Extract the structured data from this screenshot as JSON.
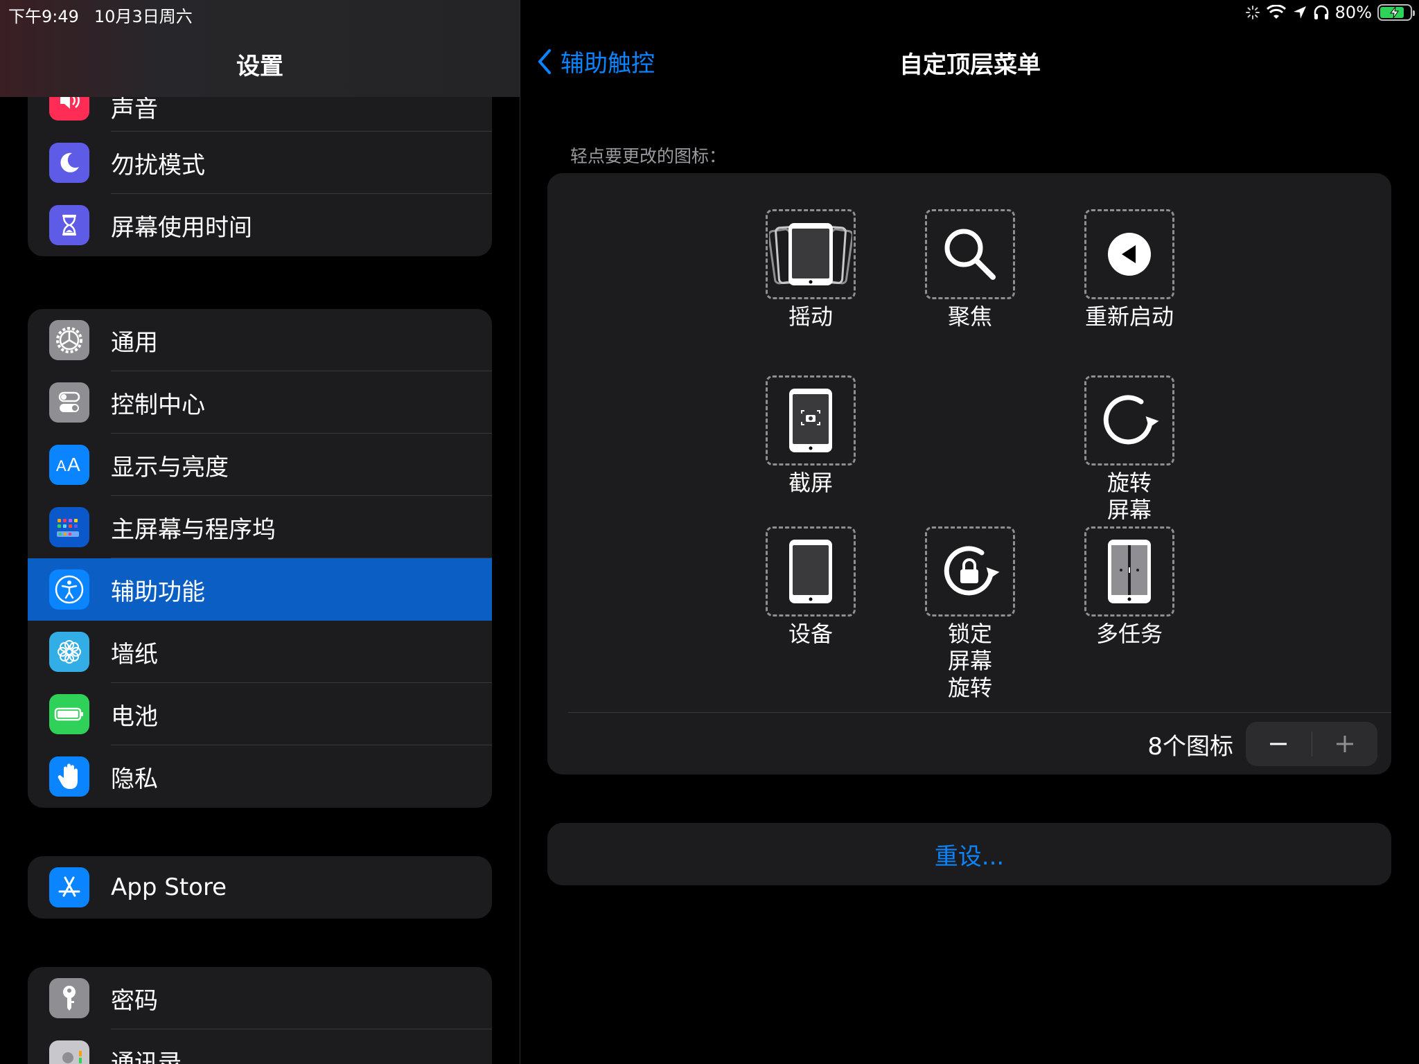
{
  "status": {
    "time": "下午9:49",
    "date": "10月3日周六",
    "battery": "80%",
    "battery_level": 0.8
  },
  "sidebar": {
    "title": "设置",
    "groups": [
      {
        "items": [
          {
            "label": "声音",
            "icon": "speaker-icon",
            "color": "#ff2d55"
          },
          {
            "label": "勿扰模式",
            "icon": "moon-icon",
            "color": "#5e5ce6"
          },
          {
            "label": "屏幕使用时间",
            "icon": "hourglass-icon",
            "color": "#5e5ce6"
          }
        ]
      },
      {
        "items": [
          {
            "label": "通用",
            "icon": "gear-icon",
            "color": "#8e8e93"
          },
          {
            "label": "控制中心",
            "icon": "toggles-icon",
            "color": "#8e8e93"
          },
          {
            "label": "显示与亮度",
            "icon": "text-size-icon",
            "color": "#0a84ff"
          },
          {
            "label": "主屏幕与程序坞",
            "icon": "home-grid-icon",
            "color": "#0a58ca"
          },
          {
            "label": "辅助功能",
            "icon": "accessibility-icon",
            "color": "#0a84ff",
            "selected": true
          },
          {
            "label": "墙纸",
            "icon": "flower-icon",
            "color": "#32ade6"
          },
          {
            "label": "电池",
            "icon": "battery-icon",
            "color": "#30d158"
          },
          {
            "label": "隐私",
            "icon": "hand-icon",
            "color": "#0a84ff"
          }
        ]
      },
      {
        "items": [
          {
            "label": "App Store",
            "icon": "app-store-icon",
            "color": "#0a84ff"
          }
        ]
      },
      {
        "items": [
          {
            "label": "密码",
            "icon": "key-icon",
            "color": "#8e8e93"
          },
          {
            "label": "通讯录",
            "icon": "contacts-icon",
            "color": "#c7c7cc"
          }
        ]
      }
    ]
  },
  "main": {
    "back_label": "辅助触控",
    "title": "自定顶层菜单",
    "hint": "轻点要更改的图标：",
    "tiles": [
      {
        "label": "摇动",
        "icon": "shake-icon"
      },
      {
        "label": "聚焦",
        "icon": "magnifier-icon"
      },
      {
        "label": "重新启动",
        "icon": "restart-icon"
      },
      {
        "label": "截屏",
        "icon": "screenshot-icon"
      },
      {
        "label": "旋转\n屏幕",
        "icon": "rotate-icon"
      },
      {
        "label": "设备",
        "icon": "device-icon"
      },
      {
        "label": "锁定\n屏幕\n旋转",
        "icon": "lock-rotation-icon"
      },
      {
        "label": "多任务",
        "icon": "multitask-icon"
      }
    ],
    "count_label": "8个图标",
    "reset_label": "重设..."
  }
}
